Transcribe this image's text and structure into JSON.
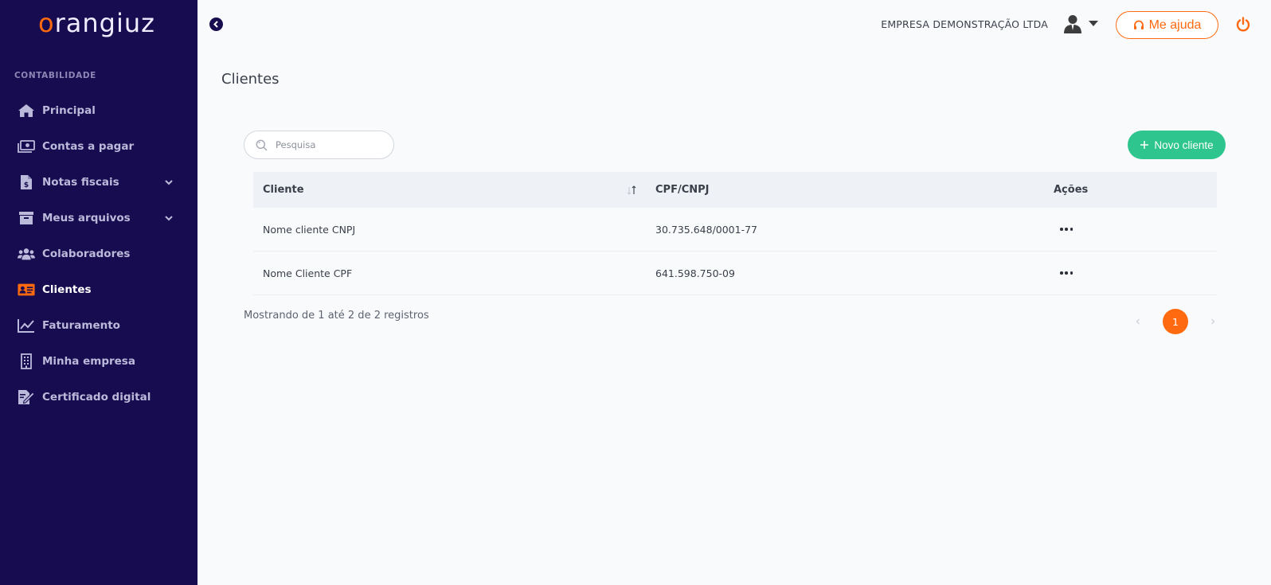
{
  "brand": {
    "name_first": "o",
    "name_rest": "rangiuz",
    "accent": "#ff6a10",
    "sidebar_bg": "#170c4f"
  },
  "sidebar": {
    "section_label": "CONTABILIDADE",
    "items": [
      {
        "label": "Principal",
        "icon": "home-icon"
      },
      {
        "label": "Contas a pagar",
        "icon": "money-bill-icon"
      },
      {
        "label": "Notas fiscais",
        "icon": "invoice-icon",
        "expandable": true
      },
      {
        "label": "Meus arquivos",
        "icon": "archive-icon",
        "expandable": true
      },
      {
        "label": "Colaboradores",
        "icon": "users-icon"
      },
      {
        "label": "Clientes",
        "icon": "id-card-icon",
        "active": true
      },
      {
        "label": "Faturamento",
        "icon": "chart-line-icon"
      },
      {
        "label": "Minha empresa",
        "icon": "building-icon"
      },
      {
        "label": "Certificado digital",
        "icon": "certificate-icon"
      }
    ]
  },
  "header": {
    "company": "EMPRESA DEMONSTRAÇÃO LTDA",
    "help_label": "Me ajuda"
  },
  "page": {
    "title": "Clientes"
  },
  "search": {
    "placeholder": "Pesquisa"
  },
  "new_button": {
    "label": "Novo cliente"
  },
  "table": {
    "columns": [
      "Cliente",
      "CPF/CNPJ",
      "Ações"
    ],
    "rows": [
      {
        "cliente": "Nome cliente CNPJ",
        "doc": "30.735.648/0001-77"
      },
      {
        "cliente": "Nome Cliente CPF",
        "doc": "641.598.750-09"
      }
    ]
  },
  "footer": {
    "info": "Mostrando de 1 até 2 de 2 registros",
    "current_page": "1"
  },
  "colors": {
    "success": "#2fc58e",
    "text": "#3a3f4a"
  }
}
